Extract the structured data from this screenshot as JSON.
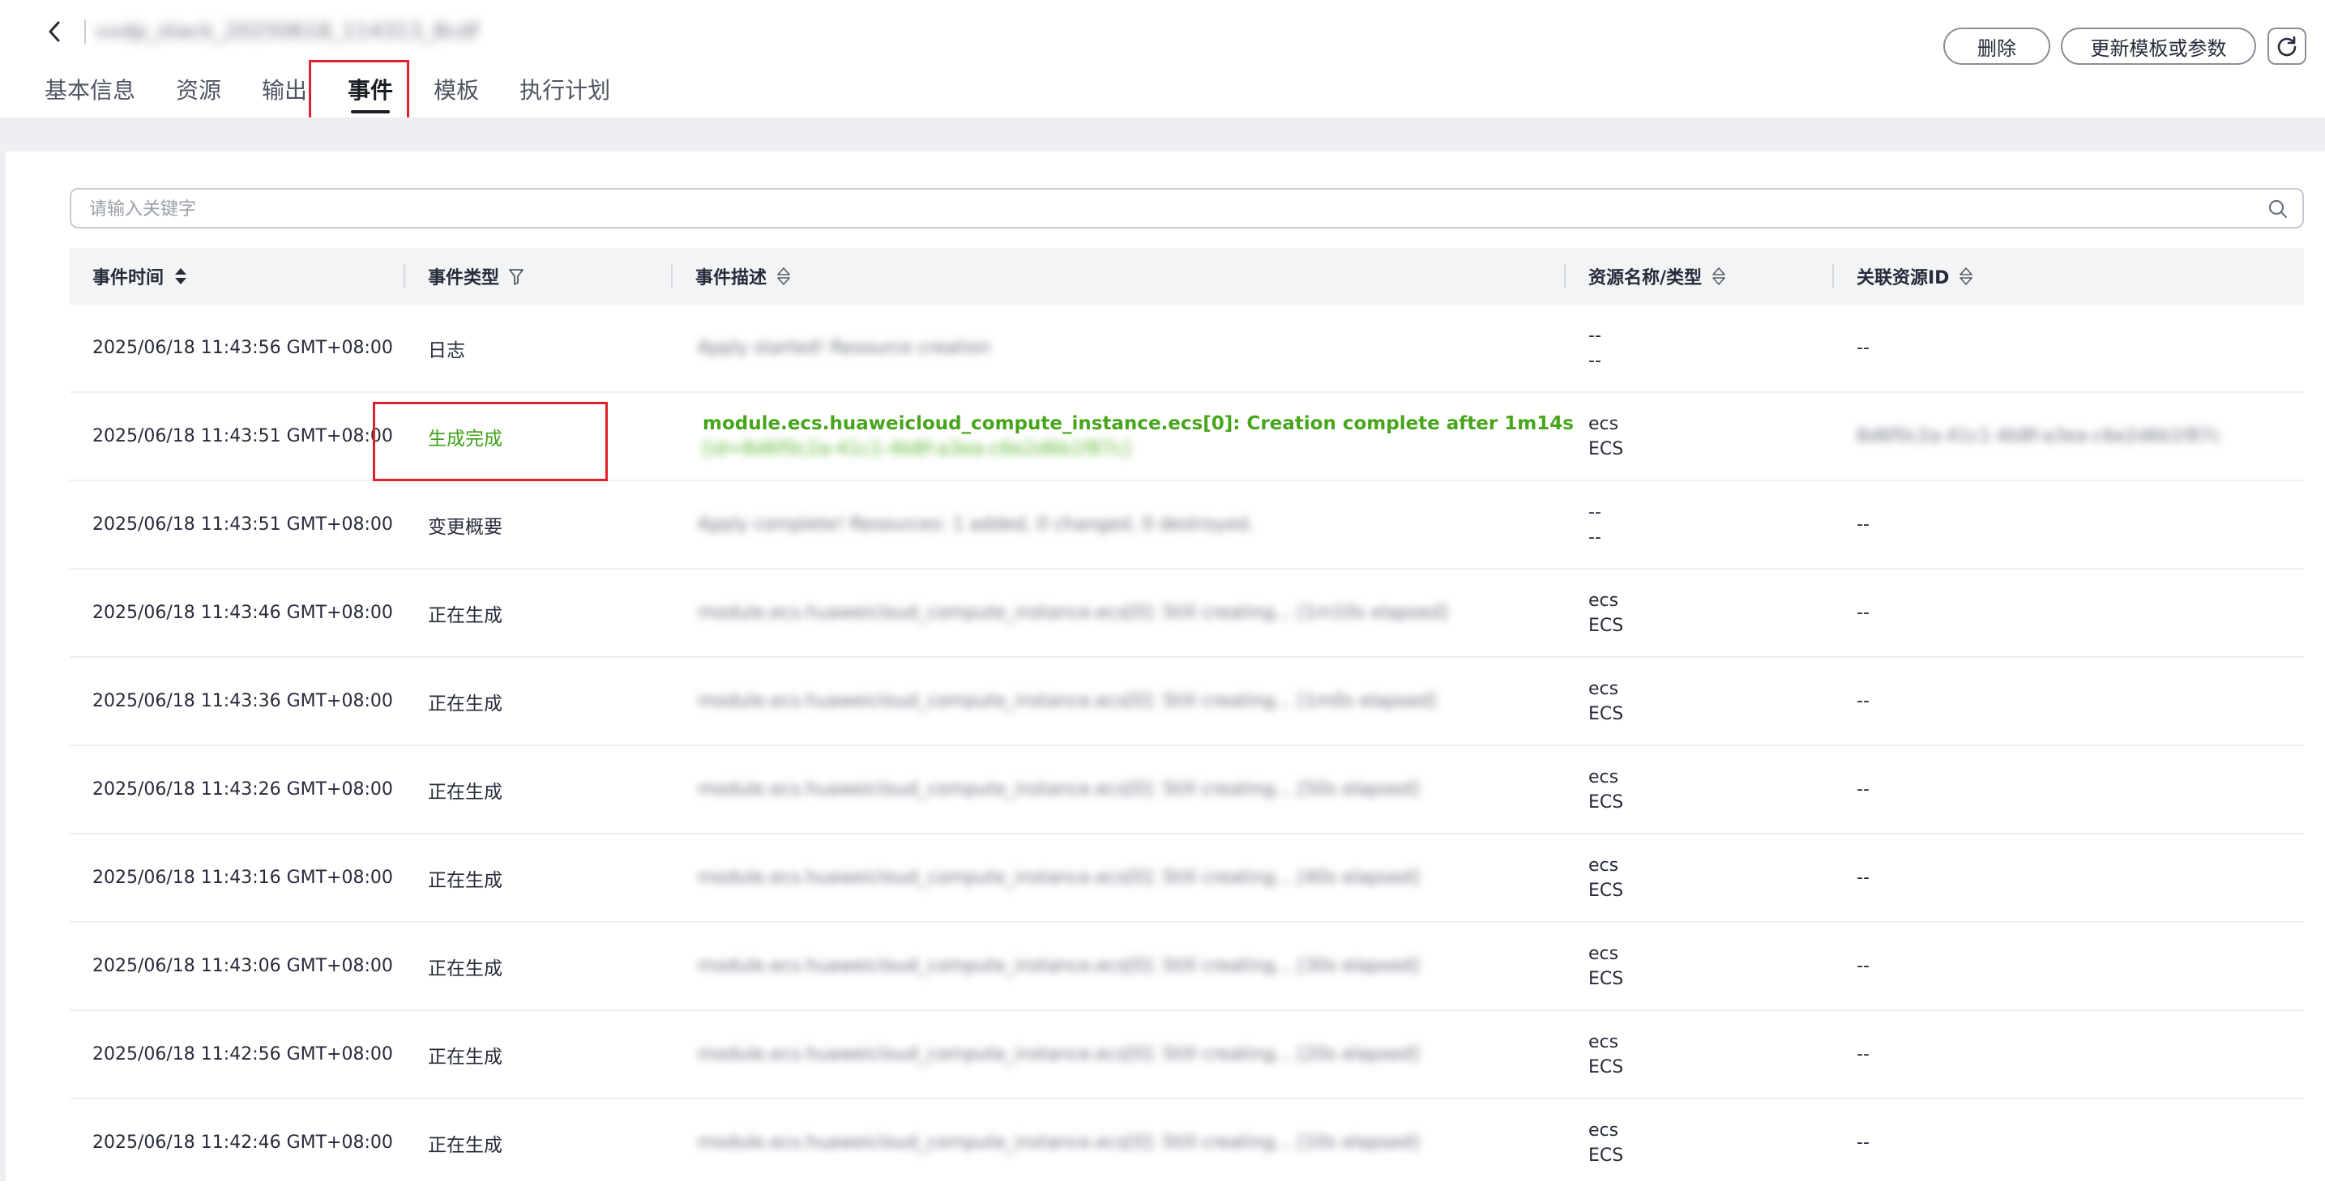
{
  "header": {
    "stack_name": "vvdp_stack_20250618_114313_8cdf",
    "tabs": [
      "基本信息",
      "资源",
      "输出",
      "事件",
      "模板",
      "执行计划"
    ],
    "active_tab": "事件",
    "delete_label": "删除",
    "update_label": "更新模板或参数"
  },
  "search": {
    "placeholder": "请输入关键字"
  },
  "table": {
    "columns": [
      "事件时间",
      "事件类型",
      "事件描述",
      "资源名称/类型",
      "关联资源ID"
    ],
    "rows": [
      {
        "time": "2025/06/18 11:43:56 GMT+08:00",
        "type": "日志",
        "desc": "Apply started! Resource creation",
        "res_name": "--",
        "res_type": "--",
        "rid": "--"
      },
      {
        "time": "2025/06/18 11:43:51 GMT+08:00",
        "type": "生成完成",
        "desc": "module.ecs.huaweicloud_compute_instance.ecs[0]: Creation complete after 1m14s",
        "desc_extra": "[id=8d6f0c2a-41c1-4b8f-a3ea-c6e2d6b1f87c]",
        "res_name": "ecs",
        "res_type": "ECS",
        "rid": "8d6f0c2a-41c1-4b8f-a3ea-c6e2d6b1f87c"
      },
      {
        "time": "2025/06/18 11:43:51 GMT+08:00",
        "type": "变更概要",
        "desc": "Apply complete! Resources: 1 added, 0 changed, 0 destroyed.",
        "res_name": "--",
        "res_type": "--",
        "rid": "--"
      },
      {
        "time": "2025/06/18 11:43:46 GMT+08:00",
        "type": "正在生成",
        "desc": "module.ecs.huaweicloud_compute_instance.ecs[0]: Still creating... [1m10s elapsed]",
        "res_name": "ecs",
        "res_type": "ECS",
        "rid": "--"
      },
      {
        "time": "2025/06/18 11:43:36 GMT+08:00",
        "type": "正在生成",
        "desc": "module.ecs.huaweicloud_compute_instance.ecs[0]: Still creating... [1m0s elapsed]",
        "res_name": "ecs",
        "res_type": "ECS",
        "rid": "--"
      },
      {
        "time": "2025/06/18 11:43:26 GMT+08:00",
        "type": "正在生成",
        "desc": "module.ecs.huaweicloud_compute_instance.ecs[0]: Still creating... [50s elapsed]",
        "res_name": "ecs",
        "res_type": "ECS",
        "rid": "--"
      },
      {
        "time": "2025/06/18 11:43:16 GMT+08:00",
        "type": "正在生成",
        "desc": "module.ecs.huaweicloud_compute_instance.ecs[0]: Still creating... [40s elapsed]",
        "res_name": "ecs",
        "res_type": "ECS",
        "rid": "--"
      },
      {
        "time": "2025/06/18 11:43:06 GMT+08:00",
        "type": "正在生成",
        "desc": "module.ecs.huaweicloud_compute_instance.ecs[0]: Still creating... [30s elapsed]",
        "res_name": "ecs",
        "res_type": "ECS",
        "rid": "--"
      },
      {
        "time": "2025/06/18 11:42:56 GMT+08:00",
        "type": "正在生成",
        "desc": "module.ecs.huaweicloud_compute_instance.ecs[0]: Still creating... [20s elapsed]",
        "res_name": "ecs",
        "res_type": "ECS",
        "rid": "--"
      },
      {
        "time": "2025/06/18 11:42:46 GMT+08:00",
        "type": "正在生成",
        "desc": "module.ecs.huaweicloud_compute_instance.ecs[0]: Still creating... [10s elapsed]",
        "res_name": "ecs",
        "res_type": "ECS",
        "rid": "--"
      }
    ]
  },
  "colors": {
    "accent": "#191d24",
    "success": "#3fa218",
    "highlight": "#e0202b"
  },
  "icons": {
    "back": "chevron-left-icon",
    "refresh": "refresh-icon",
    "search": "search-icon",
    "sort": "sort-icon",
    "filter": "filter-icon"
  }
}
